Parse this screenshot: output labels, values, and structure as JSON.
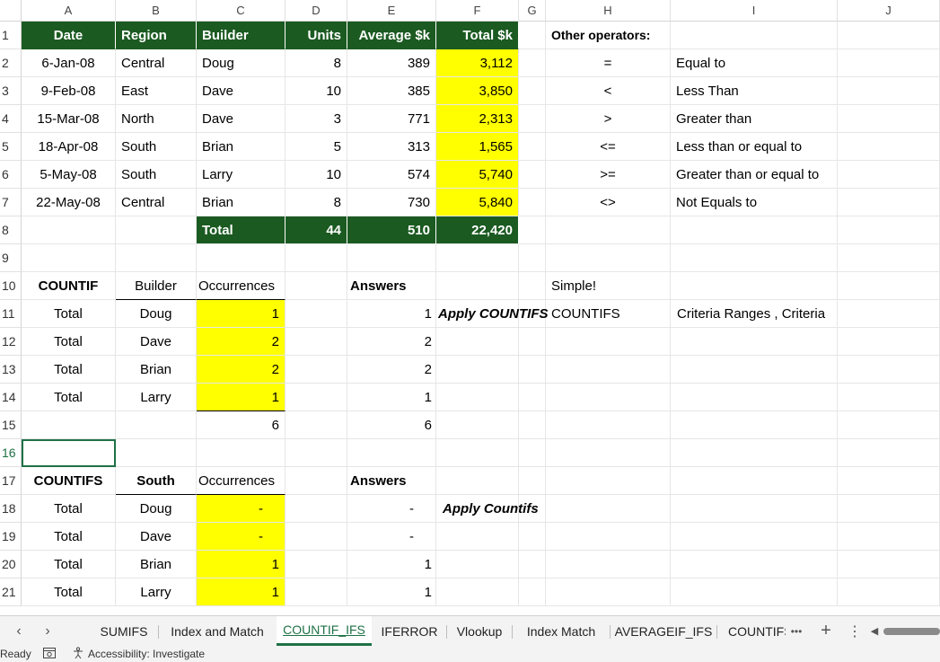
{
  "columns": [
    "A",
    "B",
    "C",
    "D",
    "E",
    "F",
    "G",
    "H",
    "I",
    "J"
  ],
  "rows": [
    "1",
    "2",
    "3",
    "4",
    "5",
    "6",
    "7",
    "8",
    "9",
    "10",
    "11",
    "12",
    "13",
    "14",
    "15",
    "16",
    "17",
    "18",
    "19",
    "20",
    "21"
  ],
  "table1": {
    "headers": [
      "Date",
      "Region",
      "Builder",
      "Units",
      "Average $k",
      "Total $k"
    ],
    "rows": [
      [
        "6-Jan-08",
        "Central",
        "Doug",
        "8",
        "389",
        "3,112"
      ],
      [
        "9-Feb-08",
        "East",
        "Dave",
        "10",
        "385",
        "3,850"
      ],
      [
        "15-Mar-08",
        "North",
        "Dave",
        "3",
        "771",
        "2,313"
      ],
      [
        "18-Apr-08",
        "South",
        "Brian",
        "5",
        "313",
        "1,565"
      ],
      [
        "5-May-08",
        "South",
        "Larry",
        "10",
        "574",
        "5,740"
      ],
      [
        "22-May-08",
        "Central",
        "Brian",
        "8",
        "730",
        "5,840"
      ]
    ],
    "total": [
      "Total",
      "44",
      "510",
      "22,420"
    ]
  },
  "operators": {
    "title": "Other operators:",
    "items": [
      [
        "=",
        "Equal to"
      ],
      [
        "<",
        "Less Than"
      ],
      [
        ">",
        "Greater than"
      ],
      [
        "<=",
        "Less than or equal to"
      ],
      [
        ">=",
        "Greater than or equal to"
      ],
      [
        "<>",
        "Not Equals to"
      ]
    ]
  },
  "countif": {
    "label": "COUNTIF",
    "col_builder": "Builder",
    "col_occ": "Occurrences",
    "answers": "Answers",
    "rows": [
      [
        "Total",
        "Doug",
        "1",
        "1"
      ],
      [
        "Total",
        "Dave",
        "2",
        "2"
      ],
      [
        "Total",
        "Brian",
        "2",
        "2"
      ],
      [
        "Total",
        "Larry",
        "1",
        "1"
      ]
    ],
    "sum_occ": "6",
    "sum_ans": "6",
    "apply": "Apply COUNTIFS",
    "simple": "Simple!",
    "fn": "COUNTIFS",
    "syntax": "Criteria Ranges , Criteria"
  },
  "countifs": {
    "label": "COUNTIFS",
    "col_region": "South",
    "col_occ": "Occurrences",
    "answers": "Answers",
    "apply": "Apply Countifs",
    "rows": [
      [
        "Total",
        "Doug",
        "-",
        "-"
      ],
      [
        "Total",
        "Dave",
        "-",
        "-"
      ],
      [
        "Total",
        "Brian",
        "1",
        "1"
      ],
      [
        "Total",
        "Larry",
        "1",
        "1"
      ]
    ]
  },
  "tabs": {
    "items": [
      "SUMIFS",
      "Index and Match",
      "COUNTIF_IFS",
      "IFERROR",
      "Vlookup",
      "Index Match",
      "AVERAGEIF_IFS",
      "COUNTIFS"
    ],
    "active": "COUNTIF_IFS",
    "more": "•••",
    "add": "+",
    "options": "⋮"
  },
  "status": {
    "ready": "Ready",
    "accessibility": "Accessibility: Investigate"
  },
  "colors": {
    "header_green": "#1b5a21",
    "highlight_yellow": "#ffff00",
    "accent": "#1e7145"
  }
}
